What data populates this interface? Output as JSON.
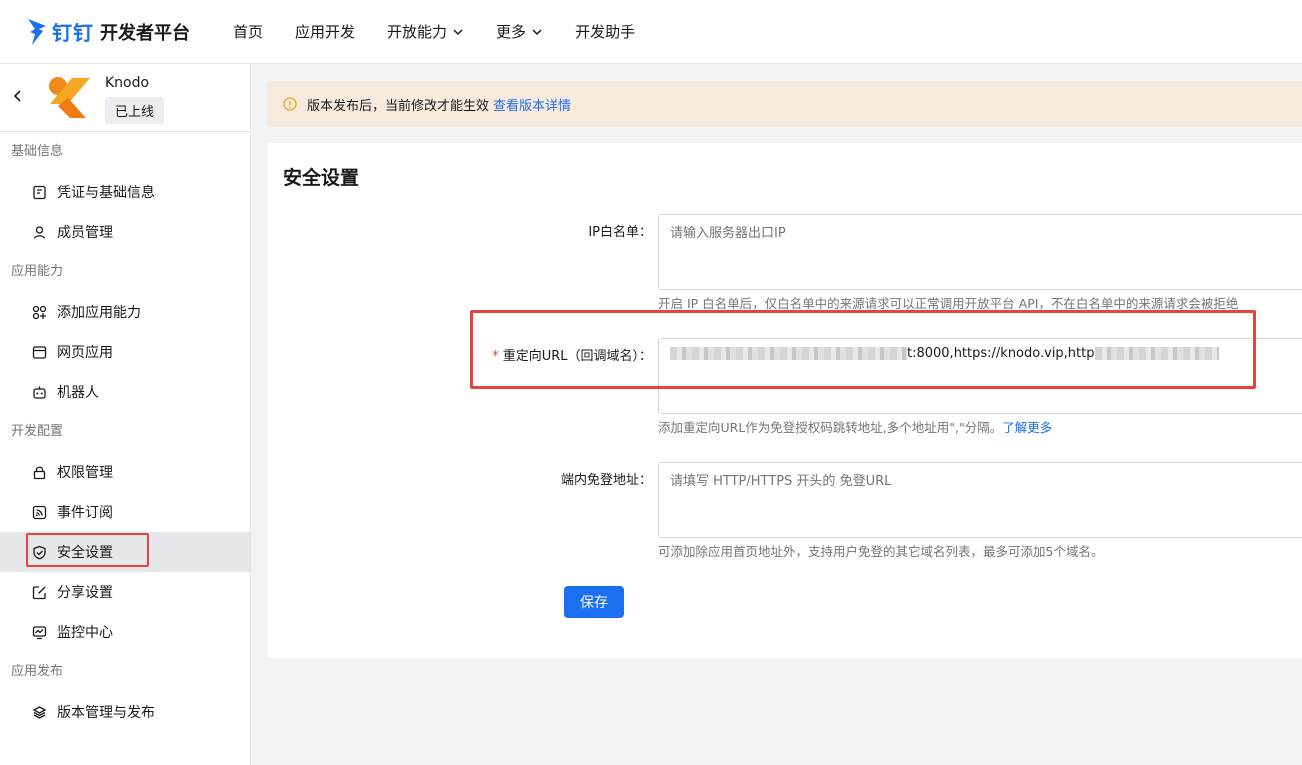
{
  "brand": {
    "name": "钉钉",
    "subtitle": "开发者平台",
    "accent": "#1b6ff0"
  },
  "nav": [
    {
      "label": "首页",
      "dropdown": false
    },
    {
      "label": "应用开发",
      "dropdown": false
    },
    {
      "label": "开放能力",
      "dropdown": true
    },
    {
      "label": "更多",
      "dropdown": true
    },
    {
      "label": "开发助手",
      "dropdown": false
    }
  ],
  "app": {
    "name": "Knodo",
    "status": "已上线"
  },
  "sidebar": {
    "groups": [
      {
        "title": "基础信息",
        "items": [
          {
            "label": "凭证与基础信息",
            "icon": "credential-icon"
          },
          {
            "label": "成员管理",
            "icon": "user-icon"
          }
        ]
      },
      {
        "title": "应用能力",
        "items": [
          {
            "label": "添加应用能力",
            "icon": "apps-add-icon"
          },
          {
            "label": "网页应用",
            "icon": "browser-icon"
          },
          {
            "label": "机器人",
            "icon": "robot-icon"
          }
        ]
      },
      {
        "title": "开发配置",
        "items": [
          {
            "label": "权限管理",
            "icon": "lock-icon"
          },
          {
            "label": "事件订阅",
            "icon": "rss-icon"
          },
          {
            "label": "安全设置",
            "icon": "shield-icon",
            "active": true
          },
          {
            "label": "分享设置",
            "icon": "share-edit-icon"
          },
          {
            "label": "监控中心",
            "icon": "monitor-icon"
          }
        ]
      },
      {
        "title": "应用发布",
        "items": [
          {
            "label": "版本管理与发布",
            "icon": "layers-icon"
          }
        ]
      }
    ]
  },
  "notice": {
    "text": "版本发布后，当前修改才能生效",
    "link": "查看版本详情",
    "icon": "info-icon"
  },
  "card": {
    "title": "安全设置"
  },
  "form": {
    "ip_whitelist": {
      "label": "IP白名单：",
      "placeholder": "请输入服务器出口IP",
      "help": "开启 IP 白名单后，仅白名单中的来源请求可以正常调用开放平台 API，不在白名单中的来源请求会被拒绝"
    },
    "redirect_url": {
      "label": "重定向URL（回调域名）：",
      "required": true,
      "value_visible": "t:8000,https://knodo.vip,http",
      "help": "添加重定向URL作为免登授权码跳转地址,多个地址用\",\"分隔。",
      "help_link": "了解更多"
    },
    "sso_address": {
      "label": "端内免登地址：",
      "placeholder": "请填写 HTTP/HTTPS 开头的 免登URL",
      "help": "可添加除应用首页地址外，支持用户免登的其它域名列表，最多可添加5个域名。"
    },
    "save_label": "保存"
  }
}
